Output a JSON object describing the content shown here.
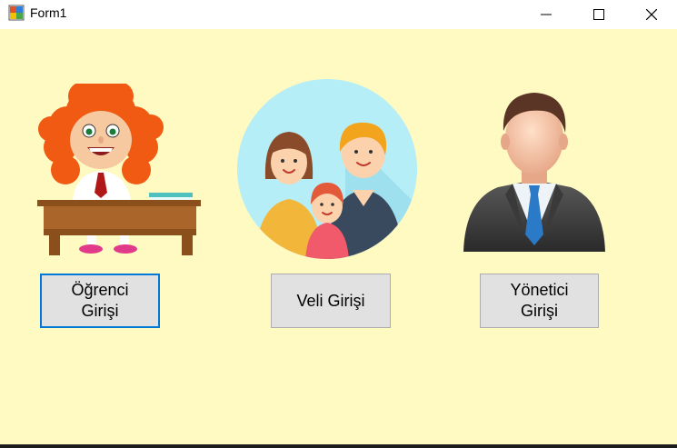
{
  "window": {
    "title": "Form1",
    "controls": {
      "minimize_icon": "minimize-icon",
      "maximize_icon": "maximize-icon",
      "close_icon": "close-icon"
    }
  },
  "form": {
    "background": "#fff9c2",
    "pictures": [
      {
        "icon": "student-at-desk-illustration"
      },
      {
        "icon": "family-illustration"
      },
      {
        "icon": "businessman-avatar"
      }
    ],
    "buttons": {
      "student": {
        "label": "Öğrenci\nGirişi"
      },
      "parent": {
        "label": "Veli Girişi"
      },
      "admin": {
        "label": "Yönetici\nGirişi"
      }
    }
  }
}
